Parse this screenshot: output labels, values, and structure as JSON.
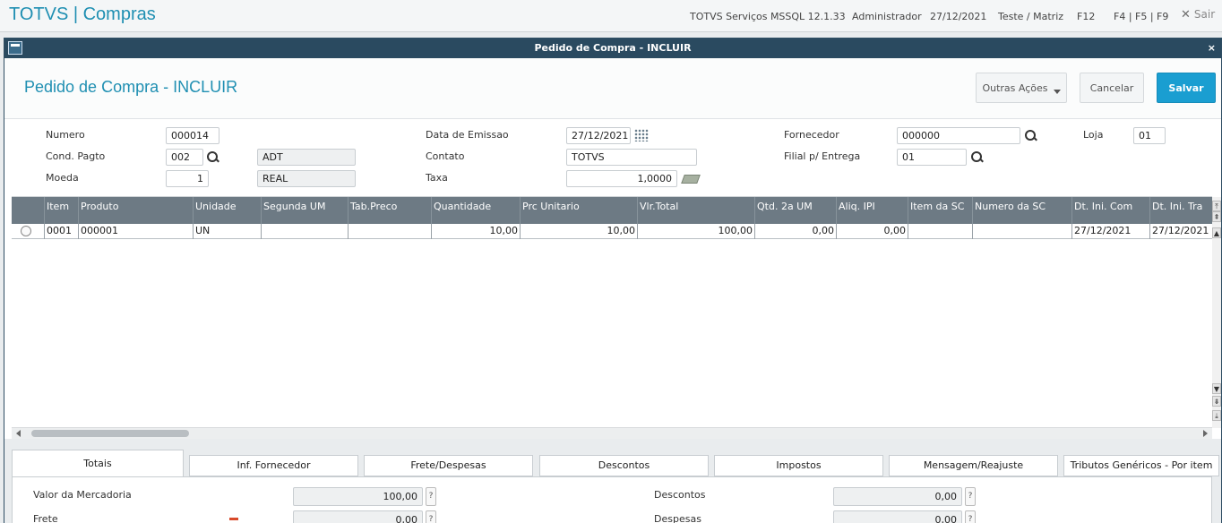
{
  "app": {
    "brand": "TOTVS | Compras",
    "server": "TOTVS Serviços MSSQL 12.1.33",
    "user": "Administrador",
    "date": "27/12/2021",
    "company": "Teste / Matriz",
    "shortcut_f12": "F12",
    "shortcut_f4": "F4 | F5 | F9",
    "exit_label": "Sair"
  },
  "window": {
    "title": "Pedido de Compra - INCLUIR",
    "close": "×"
  },
  "header": {
    "page_title": "Pedido de Compra - INCLUIR",
    "other_actions": "Outras Ações",
    "cancel": "Cancelar",
    "save": "Salvar"
  },
  "form": {
    "numero_label": "Numero",
    "numero": "000014",
    "cond_pagto_label": "Cond. Pagto",
    "cond_pagto": "002",
    "cond_pagto_desc": "ADT",
    "moeda_label": "Moeda",
    "moeda": "1",
    "moeda_desc": "REAL",
    "data_emissao_label": "Data de Emissao",
    "data_emissao": "27/12/2021",
    "contato_label": "Contato",
    "contato": "TOTVS",
    "taxa_label": "Taxa",
    "taxa": "1,0000",
    "fornecedor_label": "Fornecedor",
    "fornecedor": "000000",
    "loja_label": "Loja",
    "loja": "01",
    "filial_label": "Filial p/ Entrega",
    "filial": "01"
  },
  "grid": {
    "columns": [
      "Item",
      "Produto",
      "Unidade",
      "Segunda UM",
      "Tab.Preco",
      "Quantidade",
      "Prc Unitario",
      "Vlr.Total",
      "Qtd. 2a UM",
      "Aliq. IPI",
      "Item da SC",
      "Numero da SC",
      "Dt. Ini. Com",
      "Dt. Ini. Tra"
    ],
    "rows": [
      [
        "0001",
        "000001",
        "UN",
        "",
        "",
        "10,00",
        "10,00",
        "100,00",
        "0,00",
        "0,00",
        "",
        "",
        "27/12/2021",
        "27/12/2021"
      ]
    ]
  },
  "tabs": [
    "Totais",
    "Inf. Fornecedor",
    "Frete/Despesas",
    "Descontos",
    "Impostos",
    "Mensagem/Reajuste",
    "Tributos Genéricos - Por item"
  ],
  "totais": {
    "valor_mercadoria_label": "Valor da Mercadoria",
    "valor_mercadoria": "100,00",
    "frete_label": "Frete",
    "frete": "0,00",
    "descontos_label": "Descontos",
    "descontos": "0,00",
    "despesas_label": "Despesas",
    "despesas": "0,00",
    "help": "?"
  },
  "colors": {
    "brand": "#1f8fb2",
    "primary_button": "#1a9ed1",
    "window_titlebar": "#2a4a60",
    "grid_header": "#6d7a84"
  }
}
